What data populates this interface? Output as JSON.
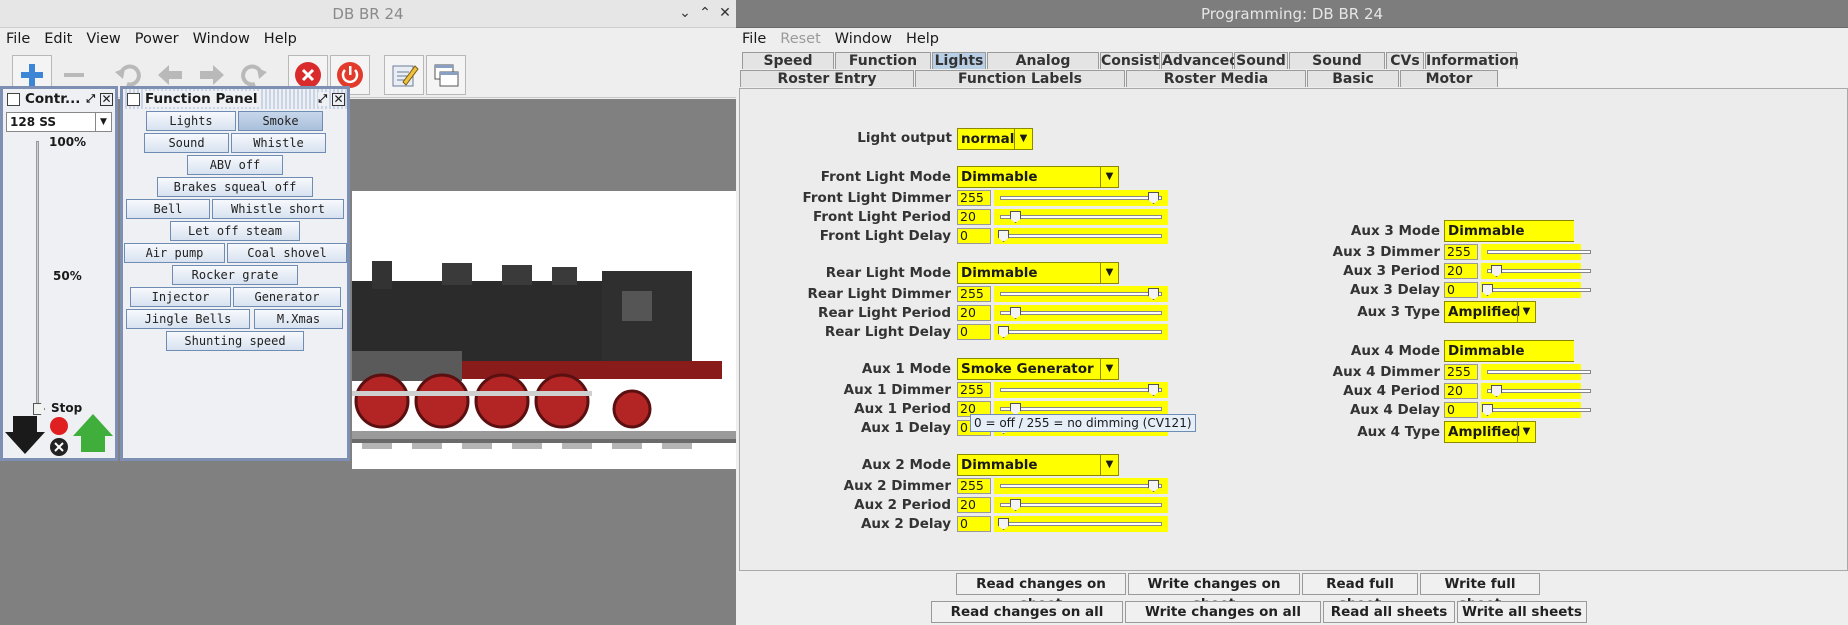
{
  "left_window": {
    "title": "DB BR 24",
    "menu": [
      "File",
      "Edit",
      "View",
      "Power",
      "Window",
      "Help"
    ],
    "toolbar_icons": [
      "add-icon",
      "remove-icon",
      "undo-icon",
      "back-icon",
      "forward-icon",
      "redo-icon",
      "stop-icon",
      "power-icon",
      "edit-icon",
      "windows-icon"
    ],
    "controller": {
      "title": "Contr...",
      "speed_steps": "128 SS",
      "label_100": "100%",
      "label_50": "50%",
      "label_stop": "Stop"
    },
    "function_panel": {
      "title": "Function Panel",
      "buttons": [
        "Lights",
        "Smoke",
        "Sound",
        "Whistle",
        "ABV off",
        "Brakes squeal off",
        "Bell",
        "Whistle short",
        "Let off steam",
        "Air pump",
        "Coal shovel",
        "Rocker grate",
        "Injector",
        "Generator",
        "Jingle Bells",
        "M.Xmas",
        "Shunting speed"
      ]
    }
  },
  "right_window": {
    "title": "Programming: DB BR 24",
    "menu": [
      "File",
      "Reset",
      "Window",
      "Help"
    ],
    "tabs_row1": [
      "Speed Table",
      "Function Map",
      "Lights",
      "Analog Controls",
      "Consist",
      "Advanced",
      "Sound",
      "Sound Levels",
      "CVs",
      "Information"
    ],
    "tabs_row2": [
      "Roster Entry",
      "Function Labels",
      "Roster Media",
      "Basic",
      "Motor"
    ],
    "selected_tab": "Lights",
    "light_output_label": "Light output",
    "light_output_value": "normal",
    "groups": [
      {
        "mode_label": "Front Light Mode",
        "mode": "Dimmable",
        "dimmer_label": "Front Light Dimmer",
        "dimmer": "255",
        "period_label": "Front Light Period",
        "period": "20",
        "delay_label": "Front Light Delay",
        "delay": "0",
        "dimmer_level": 1.0,
        "period_level": 0.08,
        "delay_level": 0.0
      },
      {
        "mode_label": "Rear Light Mode",
        "mode": "Dimmable",
        "dimmer_label": "Rear Light Dimmer",
        "dimmer": "255",
        "period_label": "Rear Light Period",
        "period": "20",
        "delay_label": "Rear Light Delay",
        "delay": "0",
        "dimmer_level": 1.0,
        "period_level": 0.08,
        "delay_level": 0.0
      },
      {
        "mode_label": "Aux 1 Mode",
        "mode": "Smoke Generator",
        "dimmer_label": "Aux 1 Dimmer",
        "dimmer": "255",
        "period_label": "Aux 1 Period",
        "period": "20",
        "delay_label": "Aux 1 Delay",
        "delay": "0",
        "dimmer_level": 1.0,
        "period_level": 0.08,
        "delay_level": 0.0
      },
      {
        "mode_label": "Aux 2 Mode",
        "mode": "Dimmable",
        "dimmer_label": "Aux 2 Dimmer",
        "dimmer": "255",
        "period_label": "Aux 2 Period",
        "period": "20",
        "delay_label": "Aux 2 Delay",
        "delay": "0",
        "dimmer_level": 1.0,
        "period_level": 0.08,
        "delay_level": 0.0
      }
    ],
    "aux_right": [
      {
        "mode_label": "Aux 3 Mode",
        "mode": "Dimmable",
        "dimmer_label": "Aux 3 Dimmer",
        "dimmer": "255",
        "period_label": "Aux 3 Period",
        "period": "20",
        "delay_label": "Aux 3 Delay",
        "delay": "0",
        "type_label": "Aux 3 Type",
        "type": "Amplified"
      },
      {
        "mode_label": "Aux 4 Mode",
        "mode": "Dimmable",
        "dimmer_label": "Aux 4 Dimmer",
        "dimmer": "255",
        "period_label": "Aux 4 Period",
        "period": "20",
        "delay_label": "Aux 4 Delay",
        "delay": "0",
        "type_label": "Aux 4 Type",
        "type": "Amplified"
      }
    ],
    "tooltip": "0 = off / 255 = no dimming (CV121)",
    "buttons_row1": [
      "Read changes on sheet",
      "Write changes on sheet",
      "Read full sheet",
      "Write full sheet"
    ],
    "buttons_row2": [
      "Read changes on all sheets",
      "Write changes on all sheets",
      "Read all sheets",
      "Write all sheets"
    ]
  }
}
